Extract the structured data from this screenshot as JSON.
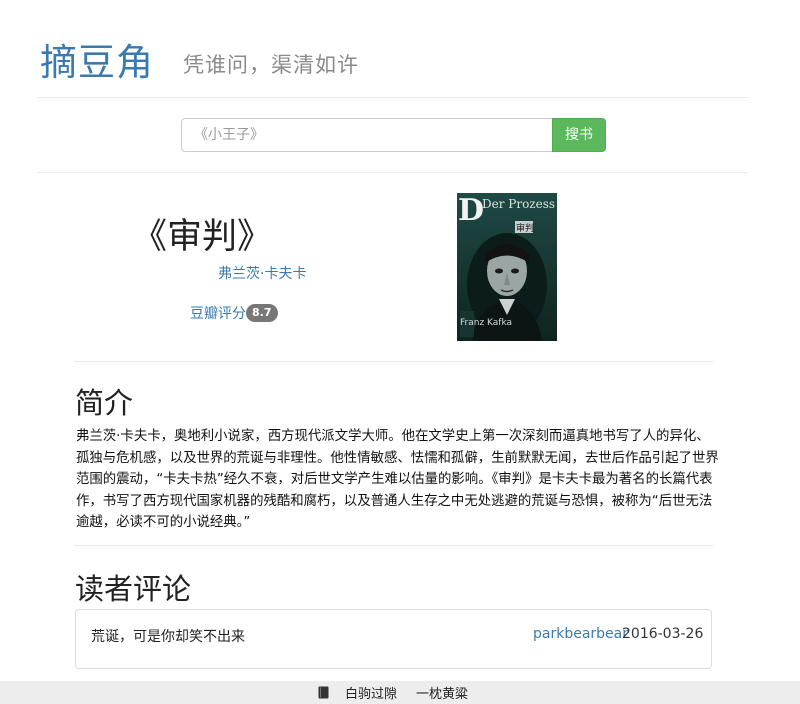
{
  "header": {
    "site_title": "摘豆角",
    "tagline": "凭谁问，渠清如许"
  },
  "search": {
    "placeholder": "《小王子》",
    "button_label": "搜书"
  },
  "book": {
    "title": "《审判》",
    "author": "弗兰茨·卡夫卡",
    "douban_label": "豆瓣评分",
    "rating": "8.7",
    "cover": {
      "text_de": "Der Prozess",
      "text_cn": "审判",
      "text_author": "Franz Kafka",
      "icon": "book-cover-portrait"
    }
  },
  "intro": {
    "heading": "简介",
    "text": "弗兰茨·卡夫卡，奥地利小说家，西方现代派文学大师。他在文学史上第一次深刻而逼真地书写了人的异化、孤独与危机感，以及世界的荒诞与非理性。他性情敏感、怯懦和孤僻，生前默默无闻，去世后作品引起了世界范围的震动，“卡夫卡热”经久不衰，对后世文学产生难以估量的影响。《审判》是卡夫卡最为著名的长篇代表作，书写了西方现代国家机器的残酷和腐朽，以及普通人生存之中无处逃避的荒诞与恐惧，被称为“后世无法逾越，必读不可的小说经典。”"
  },
  "comments": {
    "heading": "读者评论",
    "items": [
      {
        "text": "荒诞，可是你却笑不出来",
        "user": "parkbearbear",
        "date": "2016-03-26"
      }
    ]
  },
  "footer": {
    "icon": "book-icon",
    "left_link": "白驹过隙",
    "right_link": "一枕黄粱"
  },
  "colors": {
    "brand": "#3a7ab0",
    "search_button": "#5cb85c",
    "badge": "#777777"
  }
}
